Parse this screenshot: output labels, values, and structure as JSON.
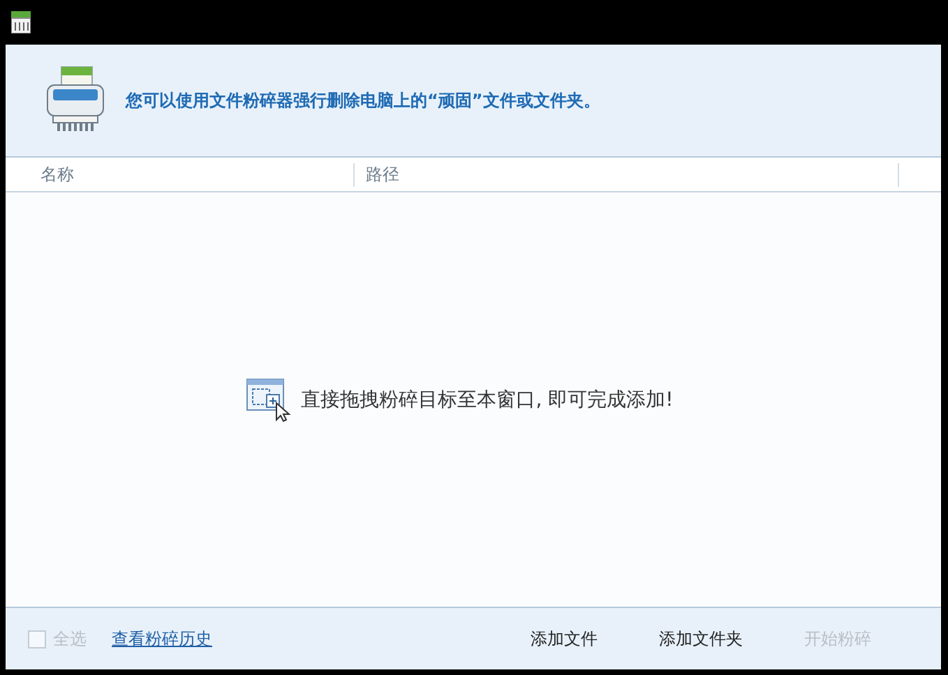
{
  "header": {
    "message": "您可以使用文件粉碎器强行删除电脑上的“顽固”文件或文件夹。"
  },
  "table": {
    "columns": [
      "名称",
      "路径"
    ]
  },
  "drop_hint": "直接拖拽粉碎目标至本窗口, 即可完成添加!",
  "footer": {
    "select_all": {
      "label": "全选",
      "checked": false,
      "disabled": true
    },
    "history_link": "查看粉碎历史",
    "buttons": [
      {
        "label": "添加文件",
        "disabled": false
      },
      {
        "label": "添加文件夹",
        "disabled": false
      },
      {
        "label": "开始粉碎",
        "disabled": true
      }
    ]
  }
}
